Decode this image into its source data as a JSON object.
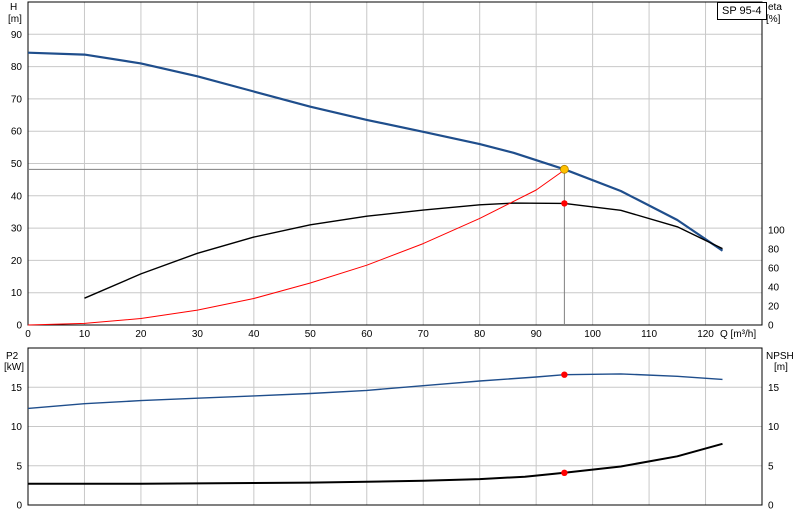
{
  "pump_label": "SP 95-4",
  "colors": {
    "head": "#1f4e8c",
    "efficiency": "#000000",
    "system_curve": "#ff0000",
    "p2": "#1f4e8c",
    "npsh": "#000000",
    "grid": "#c8c8c8",
    "op_point_main": "#ffc000",
    "op_point_marker": "#ff0000",
    "op_line": "#808080"
  },
  "chart_data": [
    {
      "type": "line",
      "title": "",
      "x_label": "Q [m³/h]",
      "y_label_left": [
        "H",
        "[m]"
      ],
      "y_label_right": [
        "eta",
        "[%]"
      ],
      "xlim": [
        0,
        130
      ],
      "ylim_left": [
        0,
        100
      ],
      "ylim_right": [
        0,
        340
      ],
      "x_ticks": [
        0,
        10,
        20,
        30,
        40,
        50,
        60,
        70,
        80,
        90,
        100,
        110,
        120
      ],
      "y_ticks_left": [
        0,
        10,
        20,
        30,
        40,
        50,
        60,
        70,
        80,
        90
      ],
      "y_ticks_right": [
        0,
        20,
        40,
        60,
        80,
        100
      ],
      "grid": true,
      "series": [
        {
          "axis": "left",
          "color_key": "head",
          "points": [
            [
              0,
              84.3
            ],
            [
              10,
              83.7
            ],
            [
              20,
              81
            ],
            [
              30,
              77
            ],
            [
              40,
              72.3
            ],
            [
              50,
              67.6
            ],
            [
              60,
              63.5
            ],
            [
              70,
              59.8
            ],
            [
              80,
              56
            ],
            [
              86,
              53.3
            ],
            [
              95,
              48.2
            ],
            [
              105,
              41.5
            ],
            [
              115,
              32.5
            ],
            [
              123,
              23
            ]
          ]
        },
        {
          "axis": "right",
          "color_key": "efficiency",
          "points": [
            [
              10,
              28.2
            ],
            [
              20,
              53.8
            ],
            [
              30,
              75.5
            ],
            [
              40,
              92.5
            ],
            [
              50,
              105.5
            ],
            [
              60,
              114.5
            ],
            [
              70,
              121
            ],
            [
              80,
              126.5
            ],
            [
              86,
              128.3
            ],
            [
              95,
              128
            ],
            [
              105,
              120.7
            ],
            [
              115,
              103.4
            ],
            [
              123,
              80.4
            ]
          ]
        },
        {
          "axis": "left",
          "color_key": "system_curve",
          "points": [
            [
              0,
              0
            ],
            [
              10,
              0.5
            ],
            [
              20,
              2
            ],
            [
              30,
              4.6
            ],
            [
              40,
              8.2
            ],
            [
              50,
              13
            ],
            [
              60,
              18.5
            ],
            [
              70,
              25.2
            ],
            [
              80,
              33
            ],
            [
              90,
              41.8
            ],
            [
              95,
              48
            ]
          ]
        }
      ],
      "operating_point": {
        "q": 95,
        "h": 48.2,
        "eta": 128
      }
    },
    {
      "type": "line",
      "title": "",
      "y_label_left": [
        "P2",
        "[kW]"
      ],
      "y_label_right": [
        "NPSH",
        "[m]"
      ],
      "xlim": [
        0,
        130
      ],
      "ylim": [
        0,
        20
      ],
      "y_ticks_left": [
        0,
        5,
        10,
        15
      ],
      "y_ticks_right": [
        0,
        5,
        10,
        15
      ],
      "grid": true,
      "series": [
        {
          "axis": "left",
          "color_key": "p2",
          "points": [
            [
              0,
              12.3
            ],
            [
              10,
              12.9
            ],
            [
              20,
              13.3
            ],
            [
              30,
              13.6
            ],
            [
              40,
              13.9
            ],
            [
              50,
              14.2
            ],
            [
              60,
              14.6
            ],
            [
              70,
              15.2
            ],
            [
              80,
              15.8
            ],
            [
              90,
              16.3
            ],
            [
              95,
              16.6
            ],
            [
              105,
              16.7
            ],
            [
              115,
              16.4
            ],
            [
              123,
              16
            ]
          ]
        },
        {
          "axis": "right",
          "color_key": "npsh",
          "points": [
            [
              0,
              2.7
            ],
            [
              10,
              2.7
            ],
            [
              20,
              2.7
            ],
            [
              30,
              2.75
            ],
            [
              40,
              2.8
            ],
            [
              50,
              2.85
            ],
            [
              60,
              2.95
            ],
            [
              70,
              3.1
            ],
            [
              80,
              3.3
            ],
            [
              88,
              3.6
            ],
            [
              95,
              4.1
            ],
            [
              105,
              4.9
            ],
            [
              115,
              6.2
            ],
            [
              123,
              7.8
            ]
          ]
        }
      ],
      "operating_point": {
        "q": 95,
        "p2": 16.6,
        "npsh": 4.1
      }
    }
  ]
}
